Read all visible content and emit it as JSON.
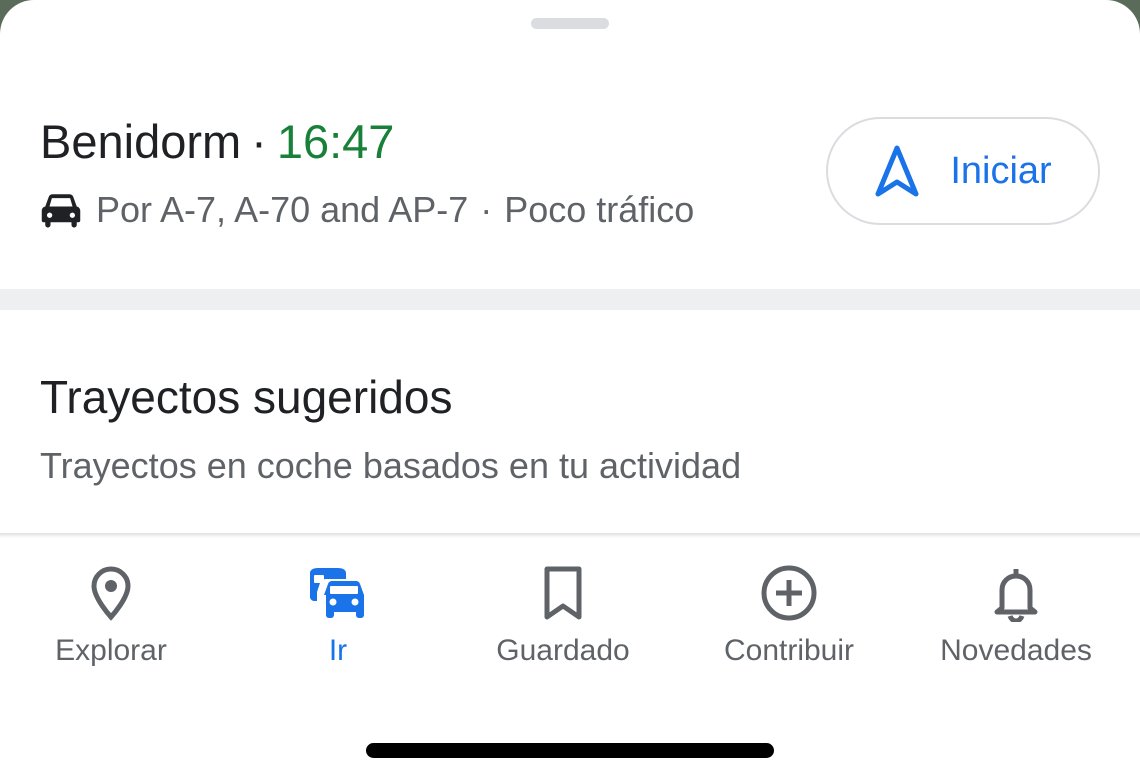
{
  "destination": {
    "name": "Benidorm",
    "separator": "·",
    "eta": "16:47"
  },
  "route": {
    "mode_icon": "car-icon",
    "via": "Por A-7, A-70 and AP-7",
    "separator": "·",
    "traffic": "Poco tráfico"
  },
  "start_button": {
    "icon": "navigation-arrow-icon",
    "label": "Iniciar"
  },
  "suggested": {
    "title": "Trayectos sugeridos",
    "subtitle": "Trayectos en coche basados en tu actividad"
  },
  "bottom_nav": {
    "items": [
      {
        "label": "Explorar",
        "icon": "location-pin-icon",
        "active": false
      },
      {
        "label": "Ir",
        "icon": "commute-icon",
        "active": true
      },
      {
        "label": "Guardado",
        "icon": "bookmark-icon",
        "active": false
      },
      {
        "label": "Contribuir",
        "icon": "add-circle-icon",
        "active": false
      },
      {
        "label": "Novedades",
        "icon": "bell-icon",
        "active": false
      }
    ]
  },
  "colors": {
    "accent": "#1a73e8",
    "eta_green": "#188038",
    "text_primary": "#202124",
    "text_secondary": "#5f6368"
  }
}
